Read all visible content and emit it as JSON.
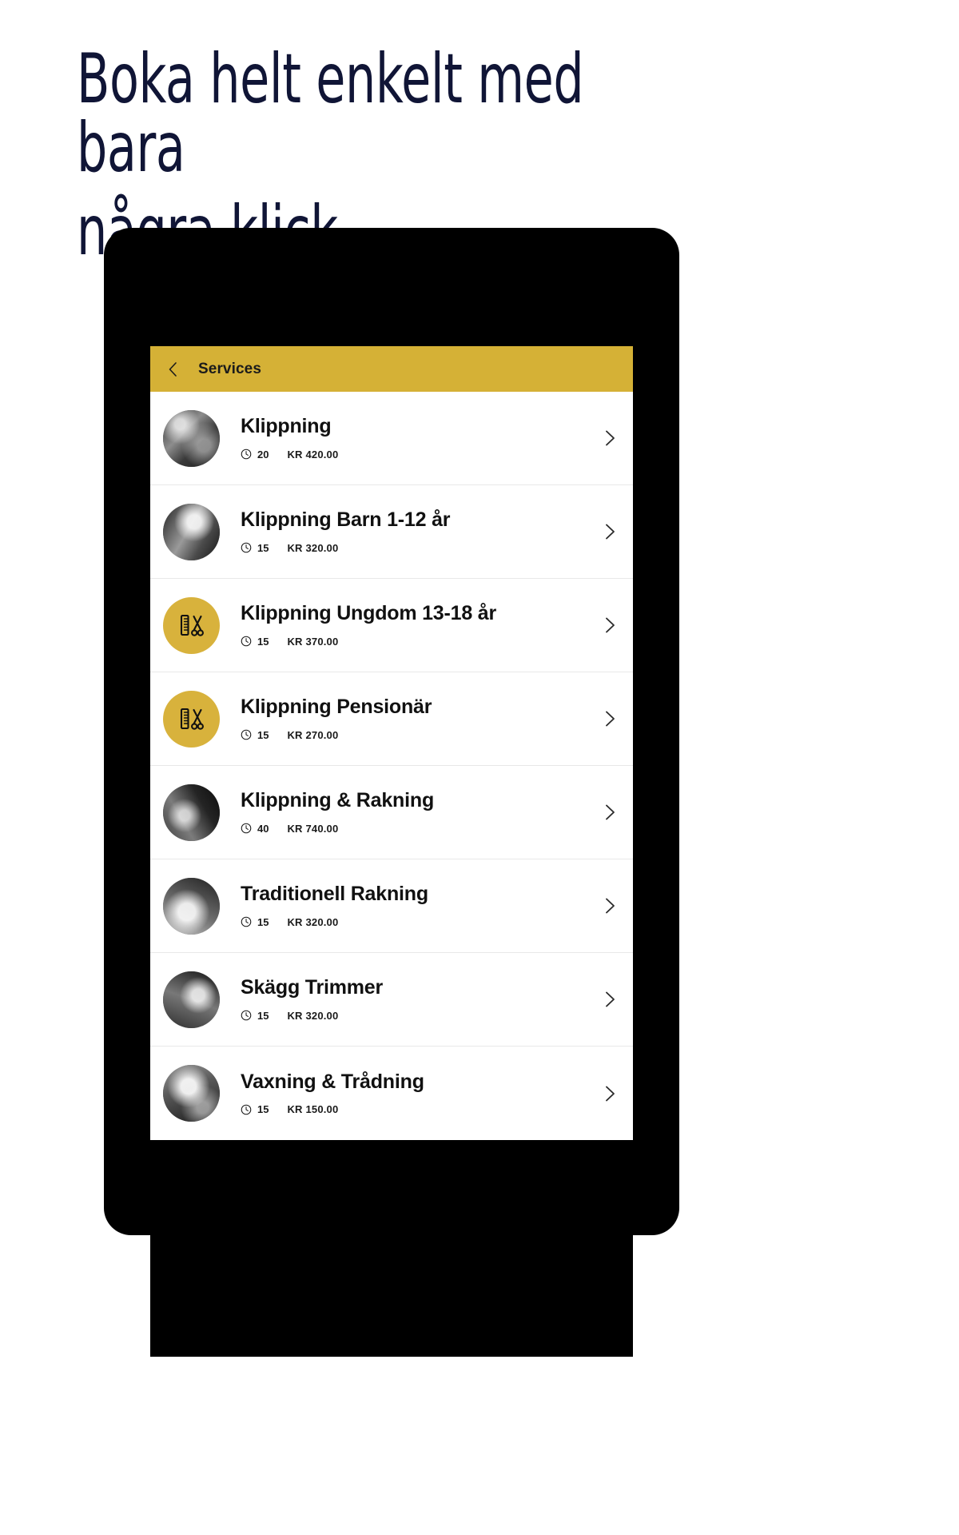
{
  "headline": {
    "line1": "Boka helt enkelt med bara",
    "line2": "några klick"
  },
  "colors": {
    "headline": "#101536",
    "header_bar": "#d5b136",
    "icon_circle": "#d8b23c",
    "device_frame": "#000000",
    "row_background": "#ffffff",
    "divider": "#e8e8e8"
  },
  "app": {
    "header": {
      "back_icon": "chevron-left-icon",
      "title": "Services"
    },
    "list": {
      "items": [
        {
          "name": "Klippning",
          "duration": "20",
          "price": "KR 420.00",
          "avatar_type": "photo",
          "clock_icon": "clock-icon",
          "chevron_icon": "chevron-right-icon"
        },
        {
          "name": "Klippning Barn 1-12 år",
          "duration": "15",
          "price": "KR 320.00",
          "avatar_type": "photo",
          "clock_icon": "clock-icon",
          "chevron_icon": "chevron-right-icon"
        },
        {
          "name": "Klippning Ungdom 13-18 år",
          "duration": "15",
          "price": "KR 370.00",
          "avatar_type": "icon",
          "avatar_icon": "comb-scissors-icon",
          "clock_icon": "clock-icon",
          "chevron_icon": "chevron-right-icon"
        },
        {
          "name": "Klippning Pensionär",
          "duration": "15",
          "price": "KR 270.00",
          "avatar_type": "icon",
          "avatar_icon": "comb-scissors-icon",
          "clock_icon": "clock-icon",
          "chevron_icon": "chevron-right-icon"
        },
        {
          "name": "Klippning & Rakning",
          "duration": "40",
          "price": "KR 740.00",
          "avatar_type": "photo",
          "clock_icon": "clock-icon",
          "chevron_icon": "chevron-right-icon"
        },
        {
          "name": "Traditionell Rakning",
          "duration": "15",
          "price": "KR 320.00",
          "avatar_type": "photo",
          "clock_icon": "clock-icon",
          "chevron_icon": "chevron-right-icon"
        },
        {
          "name": "Skägg Trimmer",
          "duration": "15",
          "price": "KR 320.00",
          "avatar_type": "photo",
          "clock_icon": "clock-icon",
          "chevron_icon": "chevron-right-icon"
        },
        {
          "name": "Vaxning & Trådning",
          "duration": "15",
          "price": "KR 150.00",
          "avatar_type": "photo",
          "clock_icon": "clock-icon",
          "chevron_icon": "chevron-right-icon"
        }
      ]
    }
  }
}
